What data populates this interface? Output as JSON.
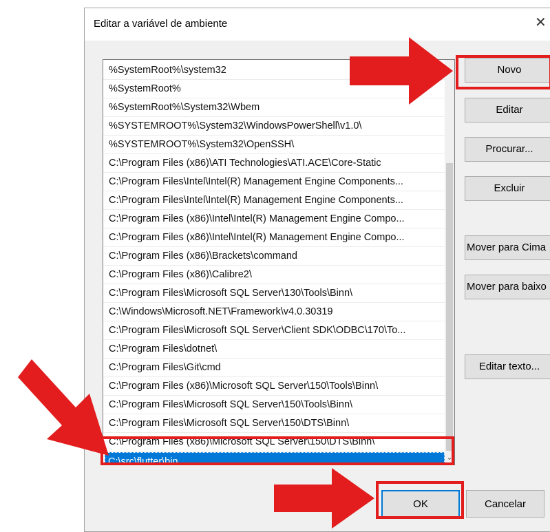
{
  "dialog": {
    "title": "Editar a variável de ambiente",
    "close_glyph": "✕"
  },
  "path_list": {
    "items": [
      "%SystemRoot%\\system32",
      "%SystemRoot%",
      "%SystemRoot%\\System32\\Wbem",
      "%SYSTEMROOT%\\System32\\WindowsPowerShell\\v1.0\\",
      "%SYSTEMROOT%\\System32\\OpenSSH\\",
      "C:\\Program Files (x86)\\ATI Technologies\\ATI.ACE\\Core-Static",
      "C:\\Program Files\\Intel\\Intel(R) Management Engine Components...",
      "C:\\Program Files\\Intel\\Intel(R) Management Engine Components...",
      "C:\\Program Files (x86)\\Intel\\Intel(R) Management Engine Compo...",
      "C:\\Program Files (x86)\\Intel\\Intel(R) Management Engine Compo...",
      "C:\\Program Files (x86)\\Brackets\\command",
      "C:\\Program Files (x86)\\Calibre2\\",
      "C:\\Program Files\\Microsoft SQL Server\\130\\Tools\\Binn\\",
      "C:\\Windows\\Microsoft.NET\\Framework\\v4.0.30319",
      "C:\\Program Files\\Microsoft SQL Server\\Client SDK\\ODBC\\170\\To...",
      "C:\\Program Files\\dotnet\\",
      "C:\\Program Files\\Git\\cmd",
      "C:\\Program Files (x86)\\Microsoft SQL Server\\150\\Tools\\Binn\\",
      "C:\\Program Files\\Microsoft SQL Server\\150\\Tools\\Binn\\",
      "C:\\Program Files\\Microsoft SQL Server\\150\\DTS\\Binn\\",
      "C:\\Program Files (x86)\\Microsoft SQL Server\\150\\DTS\\Binn\\"
    ],
    "selected_item": "C:\\src\\flutter\\bin",
    "scroll_down_glyph": "⌄"
  },
  "buttons": {
    "novo": "Novo",
    "editar": "Editar",
    "procurar": "Procurar...",
    "excluir": "Excluir",
    "mover_cima": "Mover para Cima",
    "mover_baixo": "Mover para baixo",
    "editar_texto": "Editar texto...",
    "ok": "OK",
    "cancelar": "Cancelar"
  },
  "colors": {
    "annotation_red": "#e31d1d",
    "selection_blue": "#0078d7"
  }
}
